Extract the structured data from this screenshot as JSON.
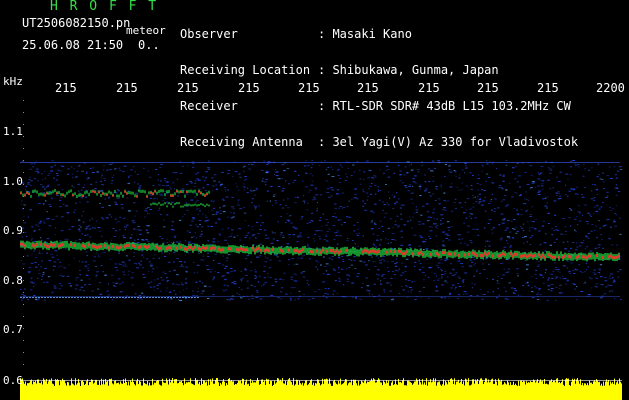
{
  "header": {
    "brand": "H R O F F T",
    "filename": "UT2506082150.pn",
    "tag": "meteor",
    "datetime": "25.06.08 21:50",
    "count": "0..",
    "fields": [
      {
        "label": "Observer",
        "value": ": Masaki Kano"
      },
      {
        "label": "Receiving Location",
        "value": ": Shibukawa, Gunma, Japan"
      },
      {
        "label": "Receiver",
        "value": ": RTL-SDR SDR# 43dB L15 103.2MHz CW"
      },
      {
        "label": "Receiving Antenna",
        "value": ": 3el Yagi(V) Az 330 for Vladivostok"
      }
    ]
  },
  "axis": {
    "y_unit": "kHz",
    "y_ticks": [
      {
        "label": "1.1",
        "value": 1.1
      },
      {
        "label": "1.0",
        "value": 1.0
      },
      {
        "label": "0.9",
        "value": 0.9
      },
      {
        "label": "0.8",
        "value": 0.8
      },
      {
        "label": "0.7",
        "value": 0.7
      },
      {
        "label": "0.6",
        "value": 0.6
      }
    ],
    "x_ticks": [
      "215",
      "215",
      "215",
      "215",
      "215",
      "215",
      "215",
      "215",
      "215",
      "2200"
    ]
  },
  "colors": {
    "header_green": "#33e04a",
    "background": "#000000",
    "signal_strong": "#ff2a2a",
    "signal_mid": "#20d040",
    "noise": "#2a4cff",
    "bottom_bar": "#ffff00"
  }
}
